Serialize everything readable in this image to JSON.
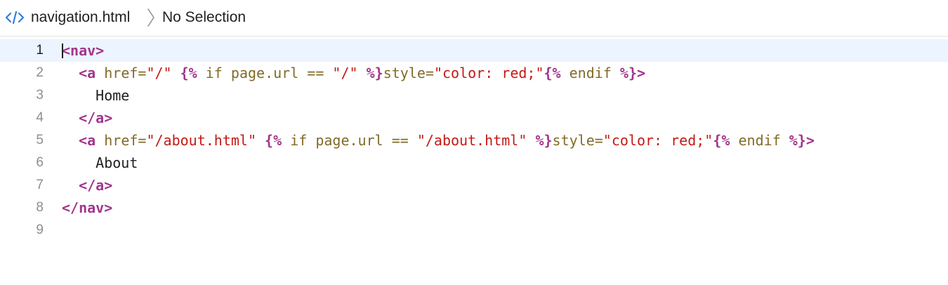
{
  "jumpbar": {
    "file_icon": "code-file-icon",
    "file_name": "navigation.html",
    "separator_icon": "chevron-right-icon",
    "selection": "No Selection"
  },
  "editor": {
    "current_line": 1,
    "lines": [
      {
        "number": "1",
        "code": "<nav>"
      },
      {
        "number": "2",
        "code": "  <a href=\"/\" {% if page.url == \"/\" %}style=\"color: red;\"{% endif %}>"
      },
      {
        "number": "3",
        "code": "    Home"
      },
      {
        "number": "4",
        "code": "  </a>"
      },
      {
        "number": "5",
        "code": "  <a href=\"/about.html\" {% if page.url == \"/about.html\" %}style=\"color: red;\"{% endif %}>"
      },
      {
        "number": "6",
        "code": "    About"
      },
      {
        "number": "7",
        "code": "  </a>"
      },
      {
        "number": "8",
        "code": "</nav>"
      },
      {
        "number": "9",
        "code": ""
      }
    ]
  },
  "colors": {
    "tag": "#a3358c",
    "attribute": "#826b28",
    "string": "#c41a16",
    "current_line_highlight": "#ecf4ff",
    "icon_accent": "#2f7fe0"
  }
}
